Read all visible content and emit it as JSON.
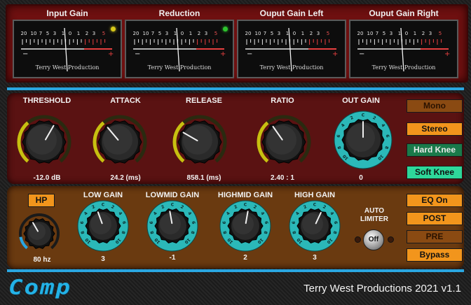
{
  "meters": [
    {
      "title": "Input Gain",
      "brand": "Terry West Production",
      "led": "#d8c81a"
    },
    {
      "title": "Reduction",
      "brand": "Terry West Production",
      "led": "#2ec42e"
    },
    {
      "title": "Ouput Gain Left",
      "brand": "Terry West Production",
      "led": ""
    },
    {
      "title": "Ouput Gain Right",
      "brand": "Terry West Production",
      "led": ""
    }
  ],
  "meter_scale": {
    "top_labels": [
      "20",
      "10",
      "7",
      "5",
      "3",
      "1",
      "0",
      "1",
      "2",
      "3"
    ],
    "minus": "−",
    "plus": "+",
    "vu_right": "5"
  },
  "knobs_main": [
    {
      "label": "THRESHOLD",
      "value": "-12.0  dB",
      "style": "yellow"
    },
    {
      "label": "ATTACK",
      "value": "24.2 (ms)",
      "style": "yellow"
    },
    {
      "label": "RELEASE",
      "value": "858.1 (ms)",
      "style": "yellow"
    },
    {
      "label": "RATIO",
      "value": "2.40 : 1",
      "style": "yellow"
    },
    {
      "label": "OUT GAIN",
      "value": "0",
      "style": "teal"
    }
  ],
  "knobs_eq": [
    {
      "label": "",
      "value": "80  hz",
      "style": "blue"
    },
    {
      "label": "LOW GAIN",
      "value": "3",
      "style": "teal"
    },
    {
      "label": "LOWMID GAIN",
      "value": "-1",
      "style": "teal"
    },
    {
      "label": "HIGHMID GAIN",
      "value": "2",
      "style": "teal"
    },
    {
      "label": "HIGH GAIN",
      "value": "3",
      "style": "teal"
    }
  ],
  "scale_ticks": [
    "10",
    "8",
    "6",
    "4",
    "2",
    "C",
    "2",
    "4",
    "6",
    "8",
    "10"
  ],
  "right_buttons": [
    {
      "label": "Mono",
      "state": "dim"
    },
    {
      "label": "Stereo",
      "state": "orange"
    },
    {
      "label": "Hard Knee",
      "state": "green"
    },
    {
      "label": "Soft Knee",
      "state": "lgreen"
    }
  ],
  "eq_buttons": [
    {
      "label": "EQ On",
      "state": "orange"
    },
    {
      "label": "POST",
      "state": "orange"
    },
    {
      "label": "PRE",
      "state": "dim"
    },
    {
      "label": "Bypass",
      "state": "orange"
    }
  ],
  "hp_button": "HP",
  "auto_limiter": {
    "label": "AUTO LIMITER",
    "button": "Off"
  },
  "logo": "Comp",
  "footer": "Terry West Productions 2021 v1.1",
  "colors": {
    "accent_blue": "#2aa6e0",
    "orange": "#f2951c",
    "teal": "#2bb8b8",
    "yellow": "#c8c010"
  }
}
